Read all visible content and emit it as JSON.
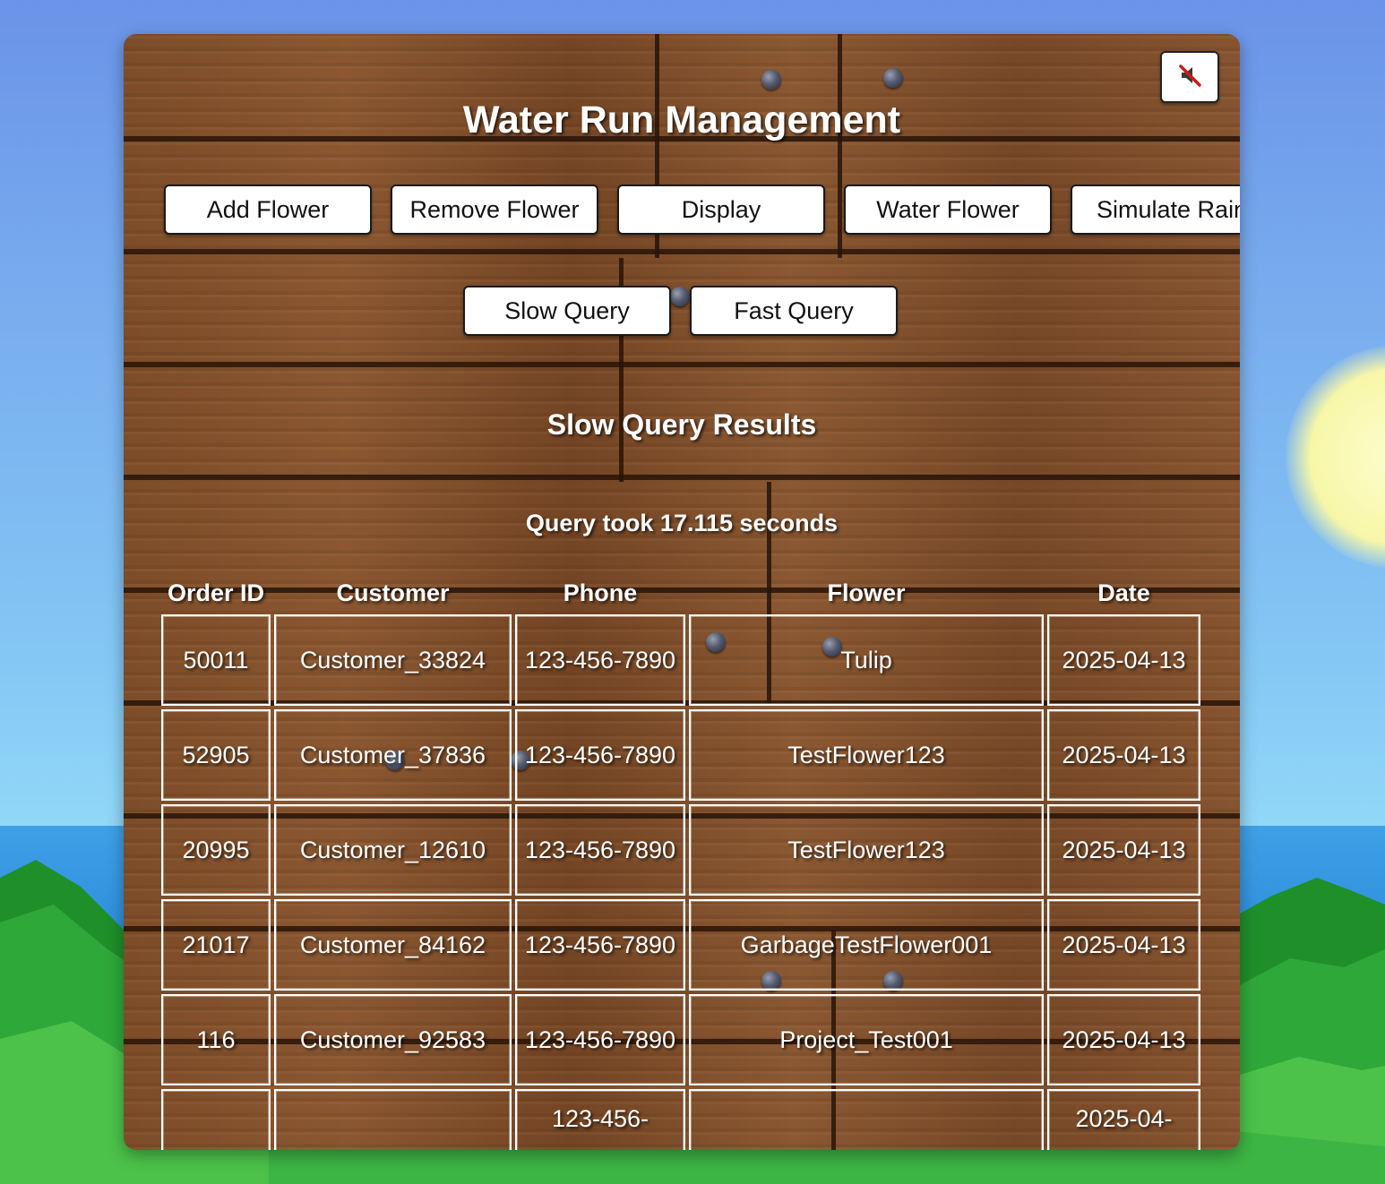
{
  "app": {
    "title": "Water Run Management",
    "mute_icon": "muted-speaker-icon"
  },
  "toolbar": {
    "add_flower": "Add Flower",
    "remove_flower": "Remove Flower",
    "display": "Display",
    "water_flower": "Water Flower",
    "simulate_rain": "Simulate Rain"
  },
  "query_buttons": {
    "slow": "Slow Query",
    "fast": "Fast Query"
  },
  "results": {
    "heading": "Slow Query Results",
    "timing": "Query took 17.115 seconds",
    "columns": [
      "Order ID",
      "Customer",
      "Phone",
      "Flower",
      "Date"
    ],
    "rows": [
      [
        "50011",
        "Customer_33824",
        "123-456-7890",
        "Tulip",
        "2025-04-13"
      ],
      [
        "52905",
        "Customer_37836",
        "123-456-7890",
        "TestFlower123",
        "2025-04-13"
      ],
      [
        "20995",
        "Customer_12610",
        "123-456-7890",
        "TestFlower123",
        "2025-04-13"
      ],
      [
        "21017",
        "Customer_84162",
        "123-456-7890",
        "GarbageTestFlower001",
        "2025-04-13"
      ],
      [
        "116",
        "Customer_92583",
        "123-456-7890",
        "Project_Test001",
        "2025-04-13"
      ],
      [
        "",
        "",
        "123-456-",
        "",
        "2025-04-"
      ]
    ]
  },
  "colors": {
    "sky": "#78acee",
    "wood": "#7d4c28",
    "button_bg": "#ffffff",
    "text": "#ffffff"
  }
}
